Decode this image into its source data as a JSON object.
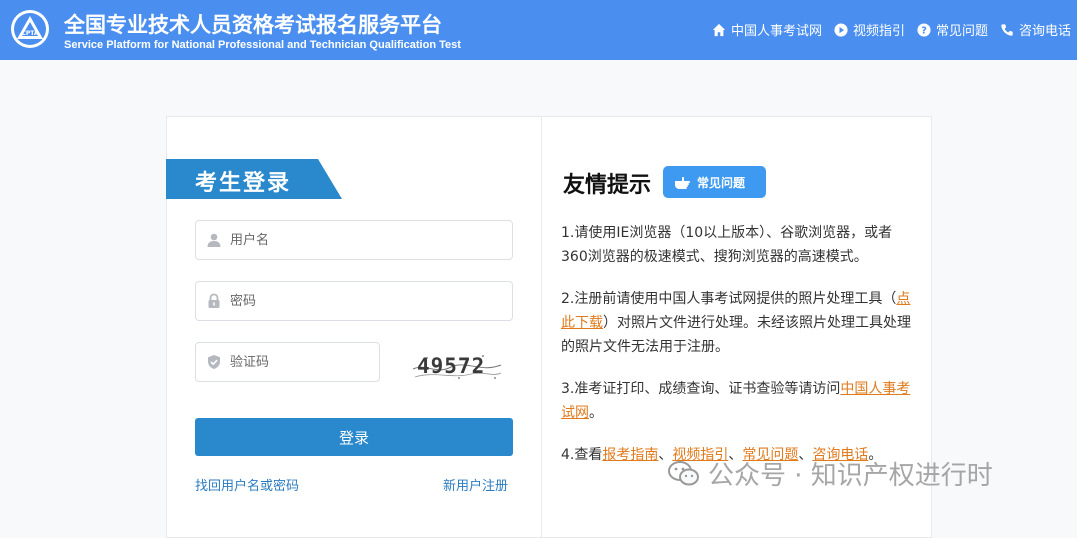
{
  "header": {
    "title_cn": "全国专业技术人员资格考试报名服务平台",
    "title_en": "Service Platform for National Professional and Technician Qualification Test",
    "logo_text": "CPTA",
    "nav": [
      {
        "label": "中国人事考试网",
        "icon": "home-icon"
      },
      {
        "label": "视频指引",
        "icon": "play-icon"
      },
      {
        "label": "常见问题",
        "icon": "question-icon"
      },
      {
        "label": "咨询电话",
        "icon": "phone-icon"
      }
    ]
  },
  "login": {
    "title": "考生登录",
    "username_placeholder": "用户名",
    "password_placeholder": "密码",
    "captcha_placeholder": "验证码",
    "captcha_text": "49572",
    "submit_label": "登录",
    "forgot_link": "找回用户名或密码",
    "register_link": "新用户注册"
  },
  "tips": {
    "title": "友情提示",
    "faq_badge": "常见问题",
    "item1": "1.请使用IE浏览器（10以上版本）、谷歌浏览器，或者360浏览器的极速模式、搜狗浏览器的高速模式。",
    "item2_a": "2.注册前请使用中国人事考试网提供的照片处理工具（",
    "item2_link": "点此下载",
    "item2_b": "）对照片文件进行处理。未经该照片处理工具处理的照片文件无法用于注册。",
    "item3_a": "3.准考证打印、成绩查询、证书查验等请访问",
    "item3_link": "中国人事考试网",
    "item3_b": "。",
    "item4_a": "4.查看",
    "item4_link1": "报考指南",
    "item4_sep1": "、",
    "item4_link2": "视频指引",
    "item4_sep2": "、",
    "item4_link3": "常见问题",
    "item4_sep3": "、",
    "item4_link4": "咨询电话",
    "item4_b": "。"
  },
  "watermark": "公众号 · 知识产权进行时",
  "colors": {
    "header_bg": "#4a8ff0",
    "accent_blue": "#2a88cc",
    "link_orange": "#e07a1c",
    "badge_blue": "#3d9af0"
  }
}
